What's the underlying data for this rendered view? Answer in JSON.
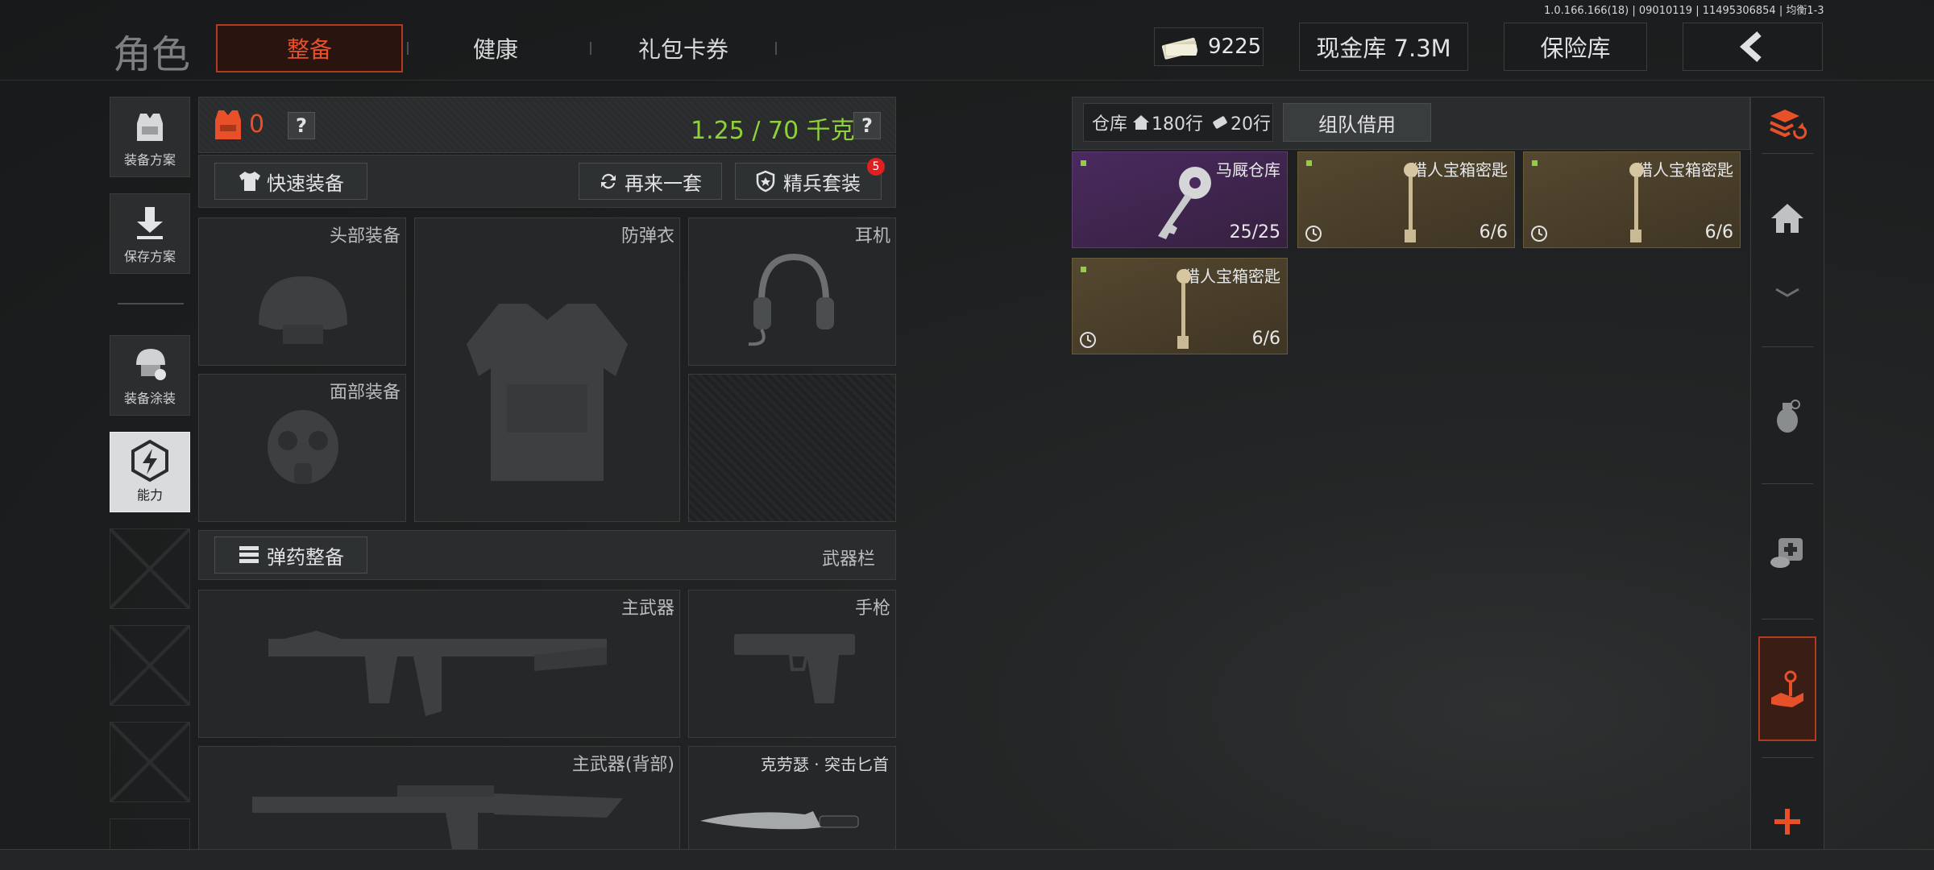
{
  "build_info": "1.0.166.166(18) | 09010119 | 11495306854 | 均衡1-3",
  "header": {
    "title": "角色",
    "tabs": [
      {
        "label": "整备",
        "active": true
      },
      {
        "label": "健康",
        "active": false
      },
      {
        "label": "礼包卡券",
        "active": false
      }
    ],
    "currency_value": "9225",
    "cash_vault": "现金库 7.3M",
    "safe_box": "保险库"
  },
  "left_sidebar": {
    "items": [
      {
        "label": "装备方案",
        "icon": "vest-plan-icon"
      },
      {
        "label": "保存方案",
        "icon": "download-icon"
      },
      {
        "label": "装备涂装",
        "icon": "helmet-paint-icon"
      },
      {
        "label": "能力",
        "icon": "ability-hex-icon",
        "active": true
      }
    ]
  },
  "loadout": {
    "armor_count": "0",
    "help": "?",
    "weight": "1.25 / 70 千克",
    "quick_equip": "快速装备",
    "again_set": "再来一套",
    "elite_set": "精兵套装",
    "elite_badge": "5",
    "slots": {
      "head": "头部装备",
      "vest": "防弹衣",
      "headset": "耳机",
      "face": "面部装备"
    },
    "ammo_button": "弹药整备",
    "weapon_bar": "武器栏",
    "weapons": {
      "primary": "主武器",
      "pistol": "手枪",
      "primary_back": "主武器(背部)",
      "melee": "克劳瑟 · 突击匕首"
    }
  },
  "warehouse": {
    "label": "仓库",
    "rows_home": "180行",
    "rows_ticket": "20行",
    "team_borrow": "组队借用",
    "items": [
      {
        "name": "马厩仓库",
        "count": "25/25",
        "color": "#3e2450"
      },
      {
        "name": "猎人宝箱密匙",
        "count": "6/6",
        "color": "#4a3f28"
      },
      {
        "name": "猎人宝箱密匙",
        "count": "6/6",
        "color": "#4a3f28"
      },
      {
        "name": "猎人宝箱密匙",
        "count": "6/6",
        "color": "#4a3f28"
      }
    ]
  },
  "right_rail": {
    "icons": [
      "stack-refresh-icon",
      "home-icon",
      "grenade-icon",
      "medkit-icon",
      "key-hand-icon",
      "plus-icon"
    ]
  },
  "colors": {
    "accent": "#e8502a",
    "weight_green": "#8fd13b",
    "purple_item": "#3e2450",
    "gold_item": "#4a3f28"
  }
}
